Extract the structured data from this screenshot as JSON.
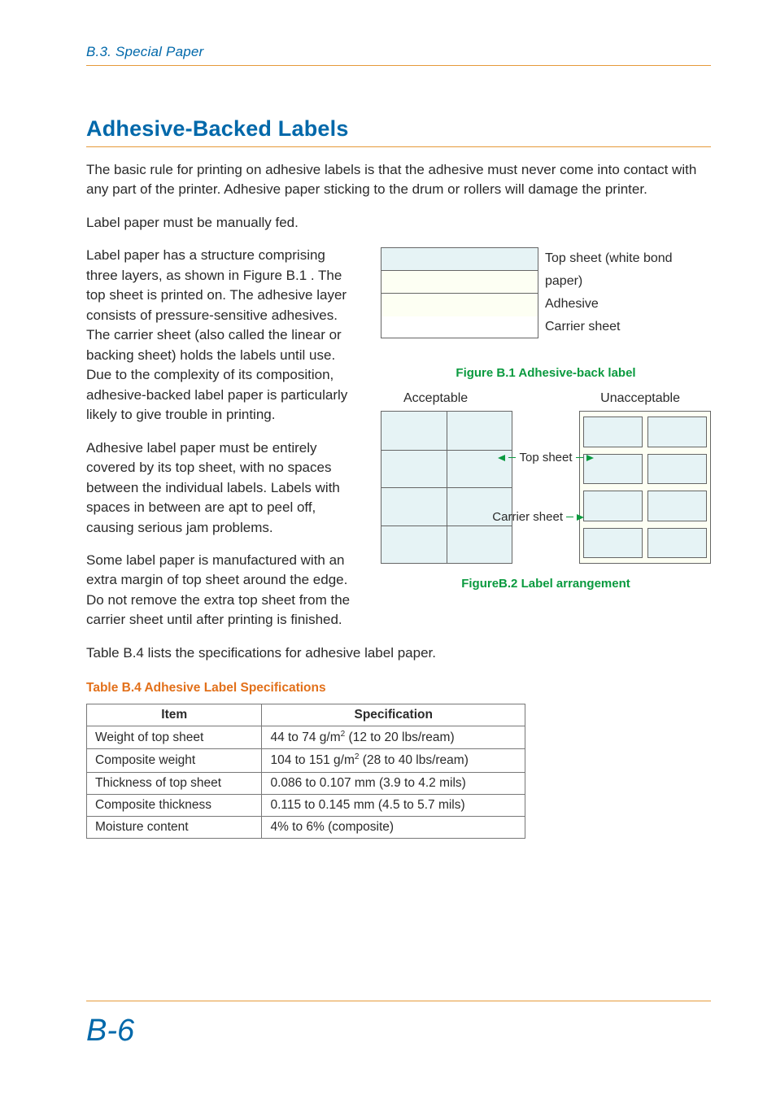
{
  "header": {
    "section": "B.3.  Special Paper"
  },
  "heading": "Adhesive-Backed Labels",
  "para1": "The basic rule for printing on adhesive labels is that the adhesive must never come into contact with any part of the printer. Adhesive paper sticking to the drum or rollers will damage the printer.",
  "para2": "Label paper must be manually fed.",
  "para3": "Label paper has a structure comprising three layers, as shown in Figure B.1 .  The top sheet is printed on. The adhesive layer consists of pressure-sensitive adhesives. The carrier sheet (also called the linear or backing sheet) holds the labels until use. Due to the complexity of its composition, adhesive-backed label paper is particularly likely to give trouble in printing.",
  "para4": "Adhesive label paper must be entirely covered by its top sheet, with no spaces between the individual labels. Labels with spaces in between are apt to peel off, causing serious jam problems.",
  "para5": "Some label paper is manufactured with an extra margin of top sheet around the edge. Do not remove the extra top sheet from the carrier sheet until after printing is finished.",
  "para6": "Table B.4  lists the specifications for adhesive label paper.",
  "figure1": {
    "labels": {
      "top": "Top sheet (white bond paper)",
      "adhesive": "Adhesive",
      "carrier": "Carrier sheet"
    },
    "caption": "Figure B.1  Adhesive-back label"
  },
  "figure2": {
    "acceptable": "Acceptable",
    "unacceptable": "Unacceptable",
    "top_sheet": "Top sheet",
    "carrier_sheet": "Carrier sheet",
    "caption": "FigureB.2  Label arrangement"
  },
  "table": {
    "caption": "Table B.4  Adhesive Label Specifications",
    "headers": {
      "item": "Item",
      "spec": "Specification"
    },
    "rows": [
      {
        "item": "Weight of top sheet",
        "spec_a": "44 to 74 g/m",
        "spec_b": " (12 to 20 lbs/ream)"
      },
      {
        "item": "Composite weight",
        "spec_a": "104 to 151 g/m",
        "spec_b": " (28 to 40 lbs/ream)"
      },
      {
        "item": "Thickness of top sheet",
        "spec_a": "0.086 to 0.107 mm (3.9 to 4.2 mils)",
        "spec_b": ""
      },
      {
        "item": "Composite thickness",
        "spec_a": "0.115 to 0.145 mm (4.5 to 5.7 mils)",
        "spec_b": ""
      },
      {
        "item": "Moisture content",
        "spec_a": "4% to 6% (composite)",
        "spec_b": ""
      }
    ]
  },
  "page_number": "B-6"
}
